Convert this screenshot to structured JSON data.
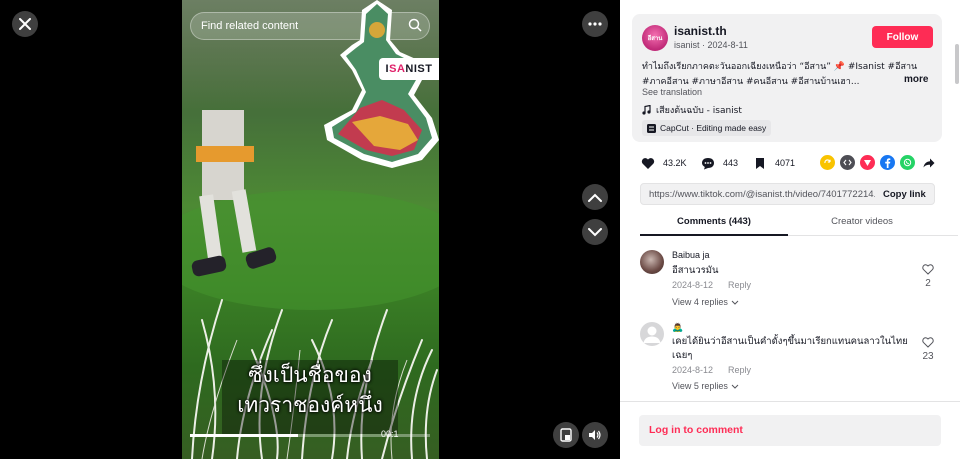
{
  "stage": {
    "search_placeholder": "Find related content",
    "brand_tag_left": "I",
    "brand_tag_pink": "SA",
    "brand_tag_right": "NIST",
    "caption_lines": [
      "ซึ่งเป็นชื่อของ",
      "เทวราชองค์หนึ่ง"
    ],
    "timecode": "00:1",
    "progress_fraction": 0.45,
    "icons": {
      "close": "close-icon",
      "more": "more-horizontal-icon",
      "up": "chevron-up-icon",
      "down": "chevron-down-icon",
      "pip": "picture-in-picture-icon",
      "volume": "volume-icon",
      "search": "search-icon"
    }
  },
  "author": {
    "avatar_text": "อีสาน",
    "name": "isanist.th",
    "handle": "isanist",
    "date": "2024-8-11",
    "follow_label": "Follow",
    "description": "ทำไมถึงเรียกภาคตะวันออกเฉียงเหนือว่า “อีสาน” 📌 #Isanist #อีสาน #ภาคอีสาน #ภาษาอีสาน #คนอีสาน #อีสานบ้านเฮา...",
    "more_label": "more",
    "see_translation": "See translation",
    "music": "เสียงต้นฉบับ - isanist",
    "capcut": "CapCut · Editing made easy"
  },
  "actions": {
    "likes": "43.2K",
    "comments": "443",
    "saves": "4071"
  },
  "share": {
    "link": "https://www.tiktok.com/@isanist.th/video/7401772214...",
    "copy_label": "Copy link"
  },
  "tabs": {
    "comments": "Comments (443)",
    "creator_videos": "Creator videos"
  },
  "comments": [
    {
      "name": "Baibua ja",
      "text": "อีสานวรมัน",
      "date": "2024-8-12",
      "reply_label": "Reply",
      "likes": "2",
      "view_replies": "View 4 replies"
    },
    {
      "name": "🙇‍♂️",
      "text": "เคยได้ยินว่าอีสานเป็นคำดั้งๆขึ้นมาเรียกแทนคนลาวในไทยเฉยๆ",
      "date": "2024-8-12",
      "reply_label": "Reply",
      "likes": "23",
      "view_replies": "View 5 replies"
    }
  ],
  "login_label": "Log in to comment",
  "colors": {
    "brand": "#fe2c55",
    "stage_bg": "#000000",
    "panel_bg": "#ffffff"
  }
}
